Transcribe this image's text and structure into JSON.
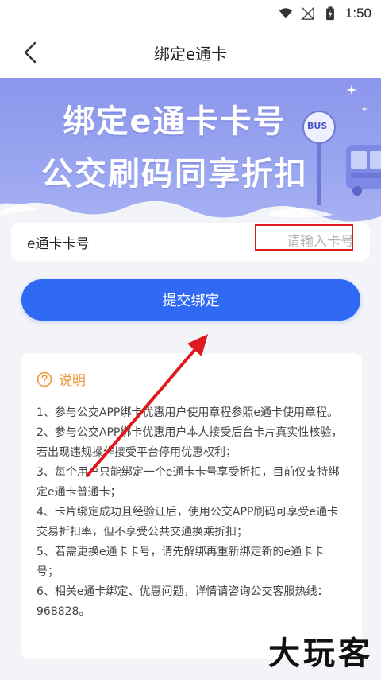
{
  "status_bar": {
    "time": "1:50"
  },
  "nav": {
    "title": "绑定e通卡"
  },
  "banner": {
    "line1": "绑定e通卡卡号",
    "line2": "公交刷码同享折扣",
    "bus_sign": "BUS"
  },
  "card_input": {
    "label": "e通卡卡号",
    "placeholder": "请输入卡号",
    "value": ""
  },
  "submit_label": "提交绑定",
  "notice": {
    "title": "说明",
    "items": [
      "1、参与公交APP绑卡优惠用户使用章程参照e通卡使用章程。",
      "2、参与公交APP绑卡优惠用户本人接受后台卡片真实性核验，若出现违规操作接受平台停用优惠权利；",
      "3、每个用户只能绑定一个e通卡卡号享受折扣，目前仅支持绑定e通卡普通卡；",
      "4、卡片绑定成功且经验证后，使用公交APP刷码可享受e通卡交易折扣率，但不享受公共交通换乘折扣；",
      "5、若需更换e通卡卡号，请先解绑再重新绑定新的e通卡卡号；",
      "6、相关e通卡绑定、优惠问题，详情请咨询公交客服热线：968828。"
    ]
  },
  "watermark": "大玩客",
  "colors": {
    "primary": "#2f69f4",
    "notice_accent": "#f0953a",
    "annotation_red": "#e0191e",
    "banner": "#8b95ec"
  }
}
